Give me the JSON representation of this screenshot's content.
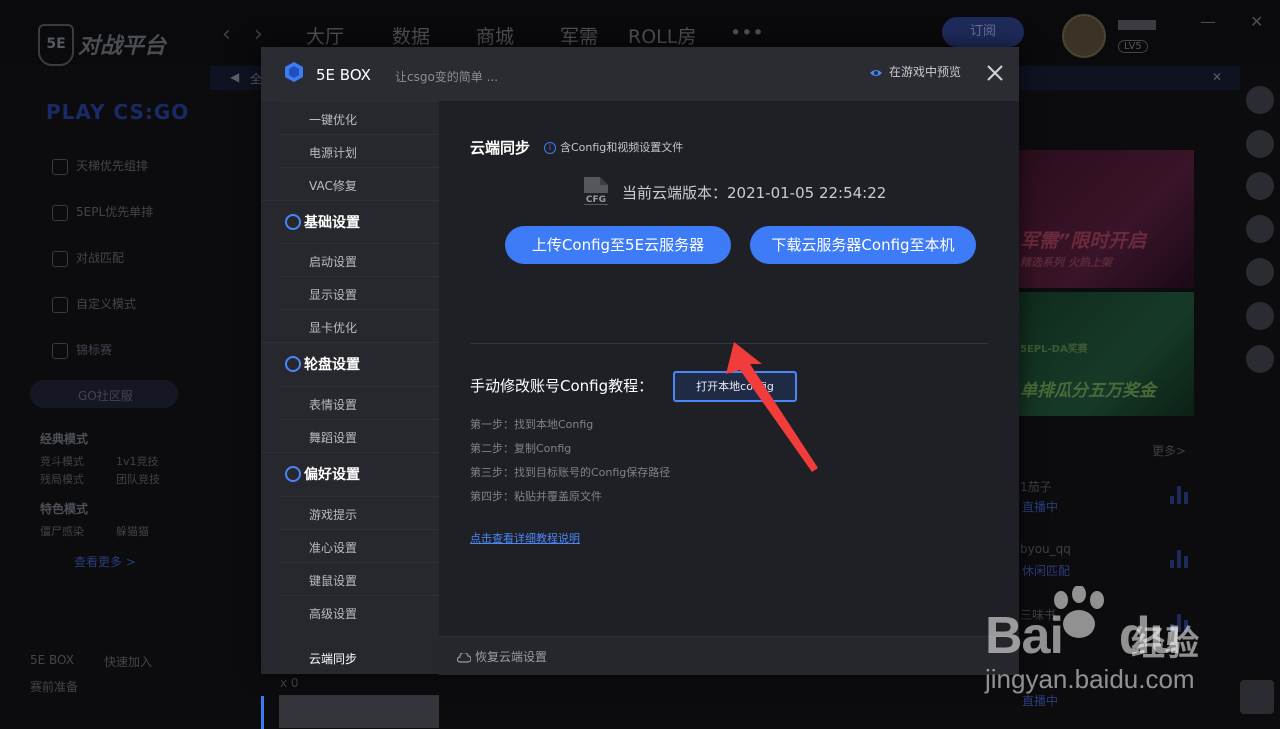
{
  "background": {
    "brand": "对战平台",
    "logo": "5E",
    "nav": [
      "大厅",
      "数据",
      "商城",
      "军需",
      "ROLL房",
      "•••"
    ],
    "subscribe_btn": "订阅",
    "user_level": "LV5",
    "notice_prefix": "全",
    "play_label": "PLAY CS:GO",
    "side_items": [
      "天梯优先组排",
      "5EPL优先单排",
      "对战匹配",
      "自定义模式",
      "锦标赛"
    ],
    "go_pill": "GO社区服",
    "classic_title": "经典模式",
    "classic_items": [
      "竞斗模式",
      "1v1竞技",
      "残局模式",
      "团队竞技"
    ],
    "special_title": "特色模式",
    "special_items": [
      "僵尸感染",
      "躲猫猫"
    ],
    "see_more": "查看更多 >",
    "bottom_box": "5E BOX",
    "bottom_quick": "快速加入",
    "bottom_ready": "赛前准备",
    "banner1": "军需”限时开启",
    "banner1_sub": "精选系列 火热上架",
    "banner2": "单排瓜分五万奖金",
    "banner2_tag": "5EPL-DA奖赛",
    "more_right": "更多>",
    "right_names": [
      "1茄子",
      "直播中",
      "byou_qq",
      "休闲匹配",
      "三味书",
      "直播中"
    ],
    "speaker_count": "x 0"
  },
  "watermark": {
    "brand": "Bai",
    "brand2": "du",
    "cn": "经验",
    "url": "jingyan.baidu.com"
  },
  "modal": {
    "title": "5E BOX",
    "subtitle": "让csgo变的简单 ...",
    "preview": "在游戏中预览",
    "sidebar": {
      "top_items": [
        "一键优化",
        "电源计划",
        "VAC修复"
      ],
      "groups": [
        {
          "title": "基础设置",
          "items": [
            "启动设置",
            "显示设置",
            "显卡优化"
          ]
        },
        {
          "title": "轮盘设置",
          "items": [
            "表情设置",
            "舞蹈设置"
          ]
        },
        {
          "title": "偏好设置",
          "items": [
            "游戏提示",
            "准心设置",
            "键鼠设置",
            "高级设置",
            "云端同步"
          ]
        }
      ],
      "active": "云端同步"
    },
    "content": {
      "title": "云端同步",
      "info": "含Config和视频设置文件",
      "cfg_label": "CFG",
      "version": "当前云端版本：2021-01-05 22:54:22",
      "upload_btn": "上传Config至5E云服务器",
      "download_btn": "下载云服务器Config至本机",
      "manual_title": "手动修改账号Config教程：",
      "open_btn": "打开本地config",
      "steps": [
        "第一步：找到本地Config",
        "第二步：复制Config",
        "第三步：找到目标账号的Config保存路径",
        "第四步：粘贴并覆盖原文件"
      ],
      "link": "点击查看详细教程说明",
      "restore": "恢复云端设置"
    }
  },
  "colors": {
    "accent": "#3e7bf6",
    "arrow": "#f23c3c"
  }
}
